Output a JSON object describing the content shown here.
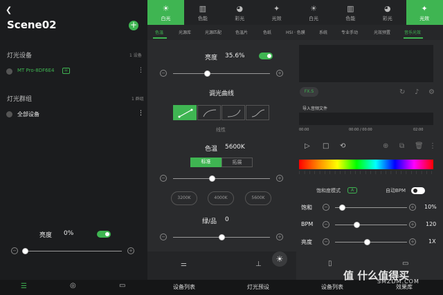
{
  "left": {
    "back_icon": "chevron-left-icon",
    "scene_title": "Scene02",
    "add_icon": "+",
    "devices_header": "灯光设备",
    "devices_count": "1 设备",
    "device_name": "MT Pro-8DF6E4",
    "device_badge": "Ⓜ",
    "groups_header": "灯光群组",
    "groups_count": "1 群组",
    "group_name": "全部设备",
    "brightness_label": "亮度",
    "brightness_value": "0%",
    "brightness_level": 0.0,
    "minus": "−",
    "plus": "+"
  },
  "main_tabs": [
    {
      "label": "白光",
      "icon": "sun-icon",
      "active": true
    },
    {
      "label": "色能",
      "icon": "bars-icon",
      "active": false
    },
    {
      "label": "彩光",
      "icon": "palette-icon",
      "active": false
    },
    {
      "label": "光效",
      "icon": "magic-wand-icon",
      "active": false
    },
    {
      "label": "白光",
      "icon": "sun-icon",
      "active": false
    },
    {
      "label": "色能",
      "icon": "bars-icon",
      "active": false
    },
    {
      "label": "彩光",
      "icon": "palette-icon",
      "active": false
    },
    {
      "label": "光效",
      "icon": "magic-wand-icon",
      "active": true
    }
  ],
  "sub_tabs_left": [
    "色温",
    "光源库",
    "光源匹配",
    "色温片",
    "色纸"
  ],
  "sub_tabs_right": [
    "HSI · 色膜",
    "系统",
    "专业手动",
    "光效预置",
    "音乐光效"
  ],
  "mid": {
    "brightness_label": "亮度",
    "brightness_value": "35.6%",
    "brightness_level": 0.356,
    "curve_label": "调光曲线",
    "curve_selected": "线性",
    "cct_label": "色温",
    "cct_value": "5600K",
    "seg_standard": "标准",
    "seg_extended": "拓展",
    "cct_presets": [
      "3200K",
      "4000K",
      "5600K"
    ],
    "cct_level": 0.4,
    "gm_label": "绿/品",
    "gm_value": "0",
    "gm_level": 0.5
  },
  "right": {
    "fx_btn": "FX.S",
    "import_label": "导入音频文件",
    "time_start": "00:00",
    "time_mid": "00:00 / 00:00",
    "time_end": "02:00",
    "sat_mode_label": "饱和度模式",
    "sat_mode_badge": "A",
    "auto_bpm_label": "自动BPM",
    "saturation_label": "饱和",
    "saturation_value": "10%",
    "saturation_level": 0.1,
    "bpm_label": "BPM",
    "bpm_value": "120",
    "bpm_level": 0.3,
    "bright_label": "亮度",
    "bright_value": "1X",
    "bright_level": 0.45
  },
  "bottom_nav": {
    "device_list": "设备列表",
    "light_preset": "灯光预设",
    "device_list2": "设备列表",
    "effect_lib": "效果库"
  },
  "watermark": {
    "main": "值 什么值得买",
    "sub": "SMZDM.COM"
  }
}
